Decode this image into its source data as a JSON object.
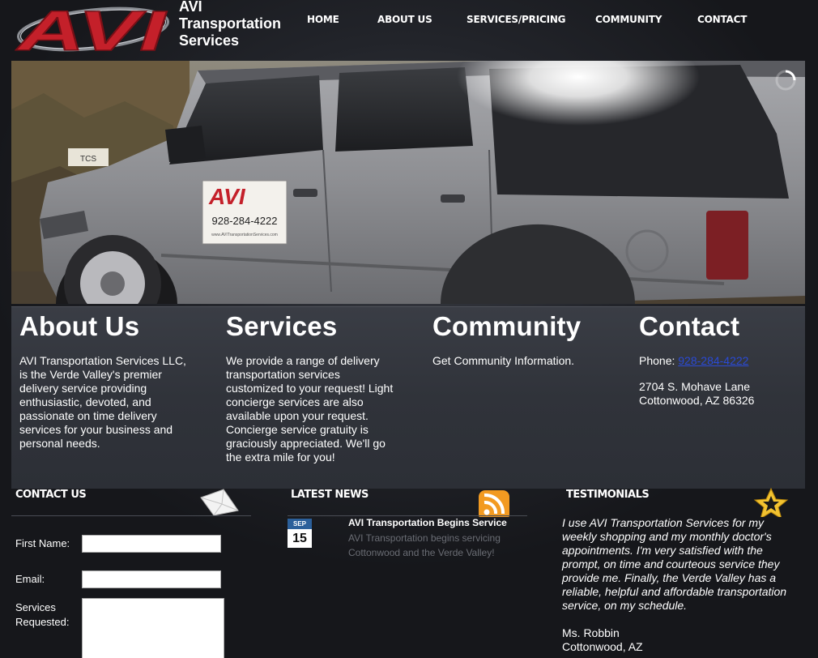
{
  "header": {
    "logo_text": "AVI",
    "site_title": "AVI Transportation Services"
  },
  "nav": {
    "items": [
      {
        "label": "HOME"
      },
      {
        "label": "ABOUT US"
      },
      {
        "label": "SERVICES/PRICING"
      },
      {
        "label": "COMMUNITY"
      },
      {
        "label": "CONTACT"
      }
    ]
  },
  "hero": {
    "door_sign_logo": "AVI",
    "door_sign_phone": "928-284-4222",
    "door_sign_web": "www.AVITransportationServices.com",
    "plate_text": "TCS"
  },
  "info": {
    "about": {
      "heading": "About Us",
      "text": "AVI Transportation Services LLC, is the Verde Valley's premier delivery service providing enthusiastic, devoted, and passionate on time delivery services for your business and personal needs."
    },
    "services": {
      "heading": "Services",
      "text": "We provide a range of delivery transportation services customized to your request! Light concierge services are also available upon your request. Concierge service gratuity is graciously appreciated. We'll go the extra mile for you!"
    },
    "community": {
      "heading": "Community",
      "text": "Get Community Information."
    },
    "contact": {
      "heading": "Contact",
      "phone_label": "Phone: ",
      "phone": "928-284-4222",
      "address_line1": "2704 S. Mohave Lane",
      "address_line2": "Cottonwood, AZ 86326"
    }
  },
  "contact_form": {
    "title": "CONTACT US",
    "first_name_label": "First Name:",
    "email_label": "Email:",
    "services_label_1": "Services",
    "services_label_2": "Requested:",
    "icon": "envelope-icon"
  },
  "news": {
    "title": "LATEST NEWS",
    "icon": "rss-icon",
    "date_month": "SEP",
    "date_day": "15",
    "item_title": "AVI Transportation Begins Service",
    "item_text": "AVI Transportation begins servicing Cottonwood and the Verde Valley!"
  },
  "testimonials": {
    "title": "TESTIMONIALS",
    "icon": "star-icon",
    "quote": "I use AVI Transportation Services for my weekly shopping and my monthly doctor's appointments. I'm very satisfied with the prompt, on time and courteous service they provide me. Finally, the Verde Valley has a reliable, helpful and affordable transportation service, on my schedule.",
    "author_name": "Ms. Robbin",
    "author_location": "Cottonwood, AZ"
  },
  "colors": {
    "background": "#1b1d22",
    "panel": "#33363d",
    "logo_red": "#c4202a",
    "link_blue": "#2a4ad6",
    "news_blue": "#2b5f9a"
  }
}
